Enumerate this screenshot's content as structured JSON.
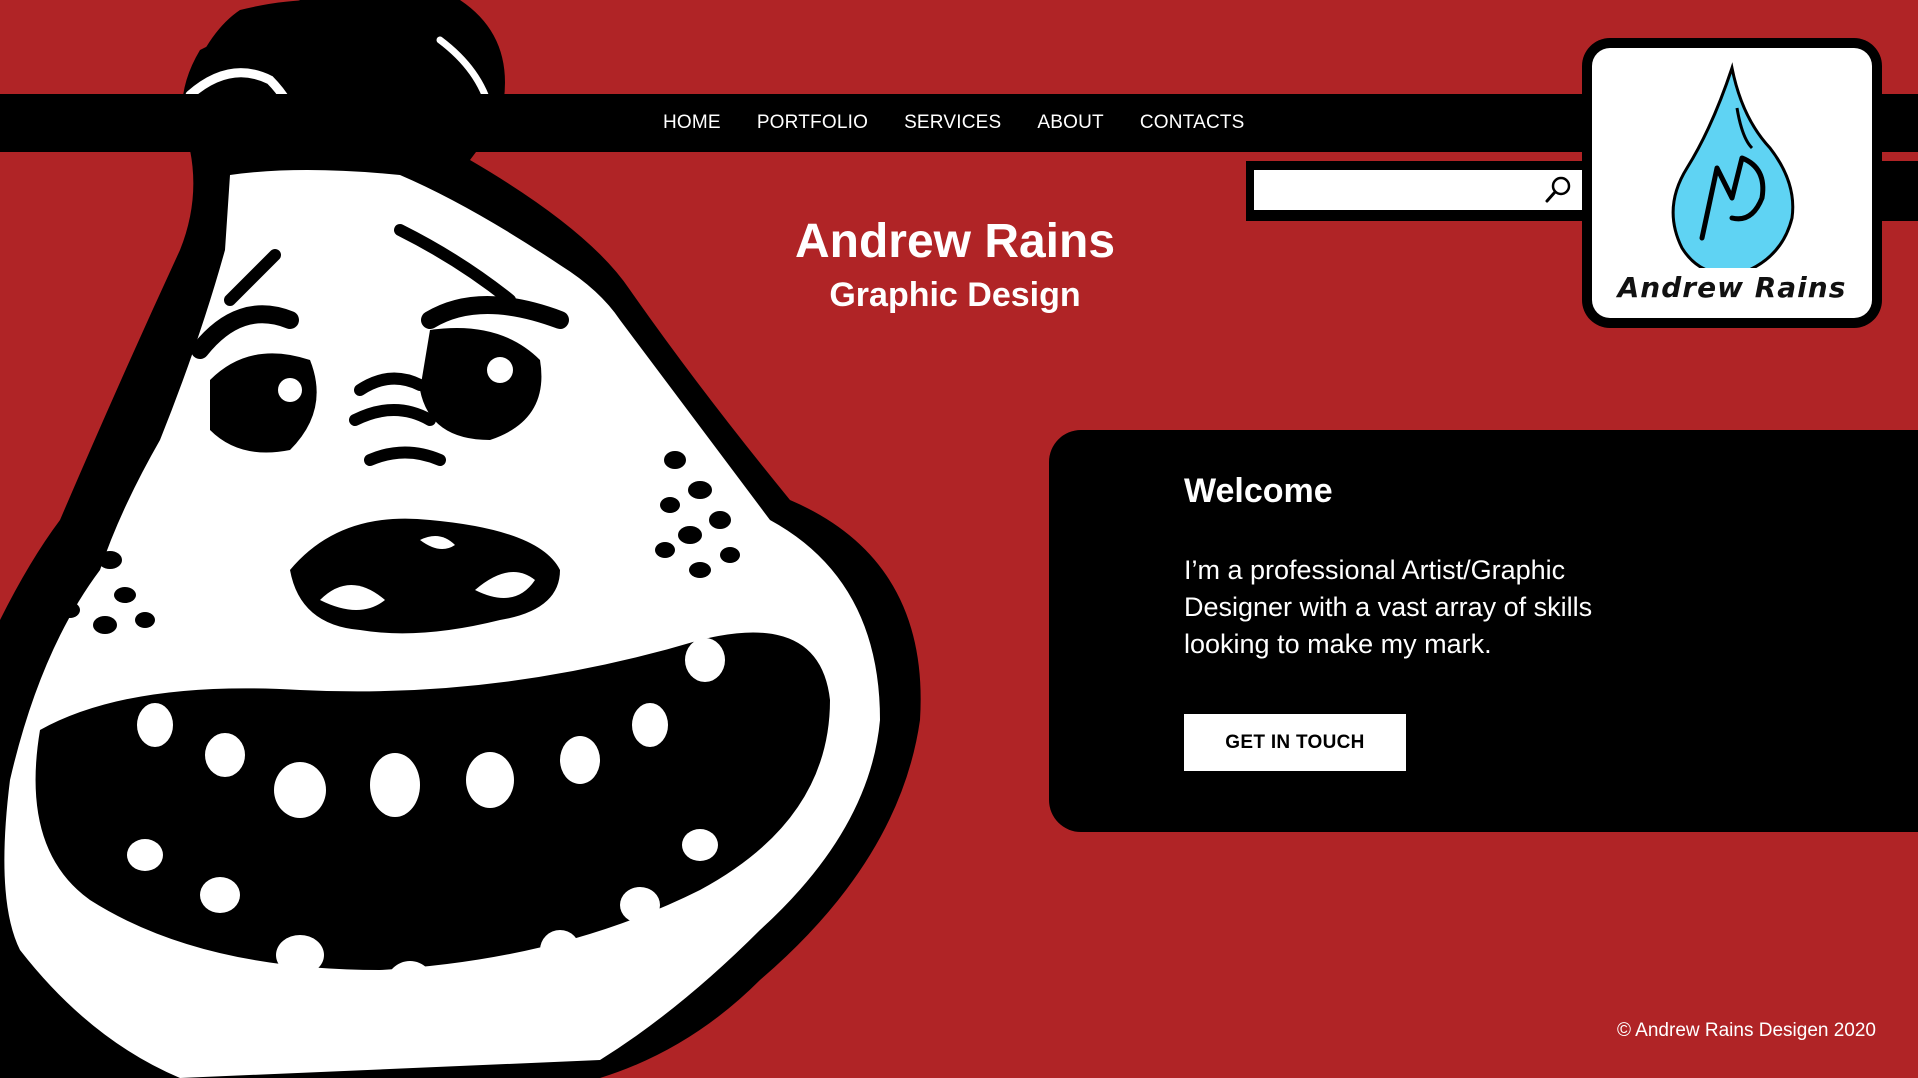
{
  "nav": {
    "items": [
      {
        "label": "HOME"
      },
      {
        "label": "PORTFOLIO"
      },
      {
        "label": "SERVICES"
      },
      {
        "label": "ABOUT"
      },
      {
        "label": "CONTACTS"
      }
    ]
  },
  "search": {
    "value": "",
    "placeholder": "",
    "icon": "search-icon"
  },
  "logo": {
    "text": "Andrew Rains",
    "drop_color": "#5fd3f3"
  },
  "hero": {
    "title": "Andrew Rains",
    "subtitle": "Graphic Design"
  },
  "welcome": {
    "title": "Welcome",
    "body": "I’m a professional Artist/Graphic Designer with a vast array of skills looking to make my mark.",
    "button_label": "GET IN TOUCH"
  },
  "footer": {
    "copyright": "© Andrew Rains Desigen 2020"
  },
  "colors": {
    "background": "#b02426",
    "panel": "#000000",
    "text": "#ffffff"
  }
}
